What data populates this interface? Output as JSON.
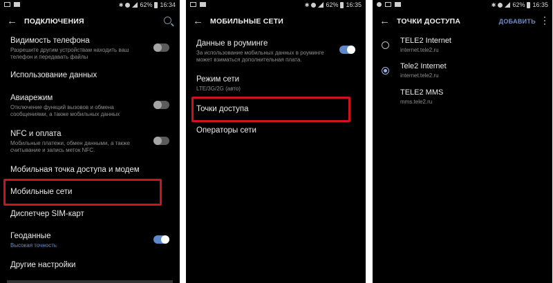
{
  "panel1": {
    "time": "16:34",
    "battery": "62%",
    "title": "ПОДКЛЮЧЕНИЯ",
    "items": [
      {
        "title": "Видимость телефона",
        "sub": "Разрешите другим устройствам находить ваш телефон и передавать файлы",
        "toggle": "off"
      },
      {
        "title": "Использование данных",
        "sub": ""
      },
      {
        "title": "Авиарежим",
        "sub": "Отключение функций вызовов и обмена сообщениями, а также мобильных данных",
        "toggle": "off"
      },
      {
        "title": "NFC и оплата",
        "sub": "Мобильные платежи, обмен данными, а также считывание и запись меток NFC.",
        "toggle": "off"
      },
      {
        "title": "Мобильная точка доступа и модем",
        "sub": ""
      },
      {
        "title": "Мобильные сети",
        "sub": ""
      },
      {
        "title": "Диспетчер SIM-карт",
        "sub": ""
      },
      {
        "title": "Геоданные",
        "sub": "Высокая точность",
        "toggle": "on"
      },
      {
        "title": "Другие настройки",
        "sub": ""
      }
    ]
  },
  "panel2": {
    "time": "16:35",
    "battery": "62%",
    "title": "МОБИЛЬНЫЕ СЕТИ",
    "items": [
      {
        "title": "Данные в роуминге",
        "sub": "За использование мобильных данных в роуминге может взиматься дополнительная плата.",
        "toggle": "on"
      },
      {
        "title": "Режим сети",
        "sub": "LTE/3G/2G (авто)"
      },
      {
        "title": "Точки доступа",
        "sub": ""
      },
      {
        "title": "Операторы сети",
        "sub": ""
      }
    ]
  },
  "panel3": {
    "time": "16:35",
    "battery": "62%",
    "title": "ТОЧКИ ДОСТУПА",
    "add_label": "ДОБАВИТЬ",
    "items": [
      {
        "title": "TELE2 Internet",
        "sub": "internet.tele2.ru",
        "selected": false
      },
      {
        "title": "Tele2 Internet",
        "sub": "internet.tele2.ru",
        "selected": true
      },
      {
        "title": "TELE2 MMS",
        "sub": "mms.tele2.ru",
        "selected": null
      }
    ]
  },
  "colors": {
    "highlight": "#d0121a",
    "accent": "#5f88c8",
    "background": "#000000"
  }
}
